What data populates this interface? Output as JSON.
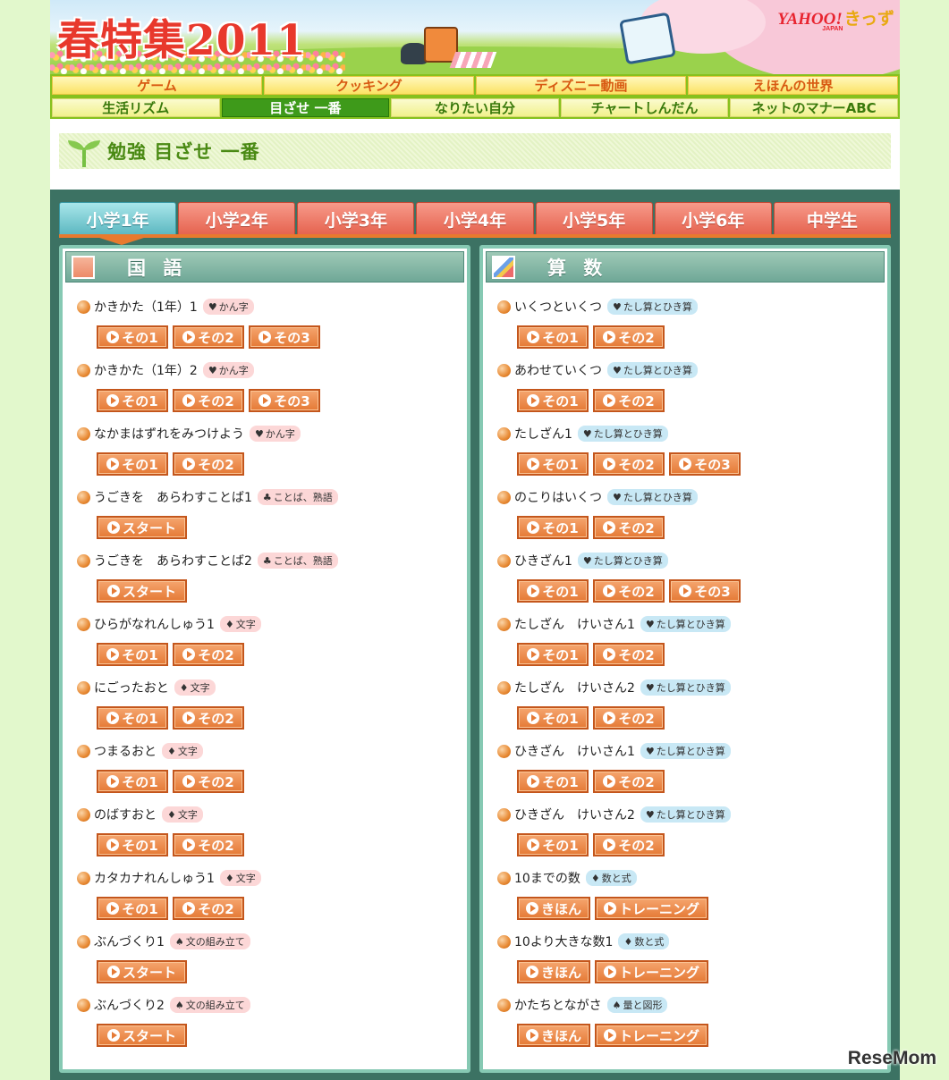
{
  "banner": {
    "title": "春特集2011",
    "logo_main": "YAHOO!",
    "logo_sub": "きっず",
    "logo_japan": "JAPAN"
  },
  "nav_top": [
    "ゲーム",
    "クッキング",
    "ディズニー動画",
    "えほんの世界"
  ],
  "nav_bottom": [
    "生活リズム",
    "目ざせ 一番",
    "なりたい自分",
    "チャートしんだん",
    "ネットのマナーABC"
  ],
  "nav_bottom_active": "目ざせ 一番",
  "heading": "勉強 目ざせ 一番",
  "grade_tabs": [
    "小学1年",
    "小学2年",
    "小学3年",
    "小学4年",
    "小学5年",
    "小学6年",
    "中学生"
  ],
  "active_grade": "小学1年",
  "left": {
    "subject": "国 語",
    "items": [
      {
        "title": "かきかた（1年）1",
        "tag_icon": "heart",
        "tag": "かん字",
        "buttons": [
          "その1",
          "その2",
          "その3"
        ]
      },
      {
        "title": "かきかた（1年）2",
        "tag_icon": "heart",
        "tag": "かん字",
        "buttons": [
          "その1",
          "その2",
          "その3"
        ]
      },
      {
        "title": "なかまはずれをみつけよう",
        "tag_icon": "heart",
        "tag": "かん字",
        "buttons": [
          "その1",
          "その2"
        ]
      },
      {
        "title": "うごきを　あらわすことば1",
        "tag_icon": "club",
        "tag": "ことば、熟語",
        "buttons": [
          "スタート"
        ]
      },
      {
        "title": "うごきを　あらわすことば2",
        "tag_icon": "club",
        "tag": "ことば、熟語",
        "buttons": [
          "スタート"
        ]
      },
      {
        "title": "ひらがなれんしゅう1",
        "tag_icon": "diamond",
        "tag": "文字",
        "buttons": [
          "その1",
          "その2"
        ]
      },
      {
        "title": "にごったおと",
        "tag_icon": "diamond",
        "tag": "文字",
        "buttons": [
          "その1",
          "その2"
        ]
      },
      {
        "title": "つまるおと",
        "tag_icon": "diamond",
        "tag": "文字",
        "buttons": [
          "その1",
          "その2"
        ]
      },
      {
        "title": "のばすおと",
        "tag_icon": "diamond",
        "tag": "文字",
        "buttons": [
          "その1",
          "その2"
        ]
      },
      {
        "title": "カタカナれんしゅう1",
        "tag_icon": "diamond",
        "tag": "文字",
        "buttons": [
          "その1",
          "その2"
        ]
      },
      {
        "title": "ぶんづくり1",
        "tag_icon": "spade",
        "tag": "文の組み立て",
        "buttons": [
          "スタート"
        ]
      },
      {
        "title": "ぶんづくり2",
        "tag_icon": "spade",
        "tag": "文の組み立て",
        "buttons": [
          "スタート"
        ]
      }
    ]
  },
  "right": {
    "subject": "算 数",
    "items": [
      {
        "title": "いくつといくつ",
        "tag_icon": "heart",
        "tag": "たし算とひき算",
        "buttons": [
          "その1",
          "その2"
        ]
      },
      {
        "title": "あわせていくつ",
        "tag_icon": "heart",
        "tag": "たし算とひき算",
        "buttons": [
          "その1",
          "その2"
        ]
      },
      {
        "title": "たしざん1",
        "tag_icon": "heart",
        "tag": "たし算とひき算",
        "buttons": [
          "その1",
          "その2",
          "その3"
        ]
      },
      {
        "title": "のこりはいくつ",
        "tag_icon": "heart",
        "tag": "たし算とひき算",
        "buttons": [
          "その1",
          "その2"
        ]
      },
      {
        "title": "ひきざん1",
        "tag_icon": "heart",
        "tag": "たし算とひき算",
        "buttons": [
          "その1",
          "その2",
          "その3"
        ]
      },
      {
        "title": "たしざん　けいさん1",
        "tag_icon": "heart",
        "tag": "たし算とひき算",
        "buttons": [
          "その1",
          "その2"
        ]
      },
      {
        "title": "たしざん　けいさん2",
        "tag_icon": "heart",
        "tag": "たし算とひき算",
        "buttons": [
          "その1",
          "その2"
        ]
      },
      {
        "title": "ひきざん　けいさん1",
        "tag_icon": "heart",
        "tag": "たし算とひき算",
        "buttons": [
          "その1",
          "その2"
        ]
      },
      {
        "title": "ひきざん　けいさん2",
        "tag_icon": "heart",
        "tag": "たし算とひき算",
        "buttons": [
          "その1",
          "その2"
        ]
      },
      {
        "title": "10までの数",
        "tag_icon": "diamond",
        "tag": "数と式",
        "buttons": [
          "きほん",
          "トレーニング"
        ]
      },
      {
        "title": "10より大きな数1",
        "tag_icon": "diamond",
        "tag": "数と式",
        "buttons": [
          "きほん",
          "トレーニング"
        ]
      },
      {
        "title": "かたちとながさ",
        "tag_icon": "spade",
        "tag": "量と図形",
        "buttons": [
          "きほん",
          "トレーニング"
        ]
      }
    ]
  },
  "watermark": "ReseMom",
  "colors": {
    "accent_orange": "#e57a36",
    "nav_green": "#86c11e",
    "main_bg": "#3c7263",
    "page_bg": "#e2f8cc"
  }
}
